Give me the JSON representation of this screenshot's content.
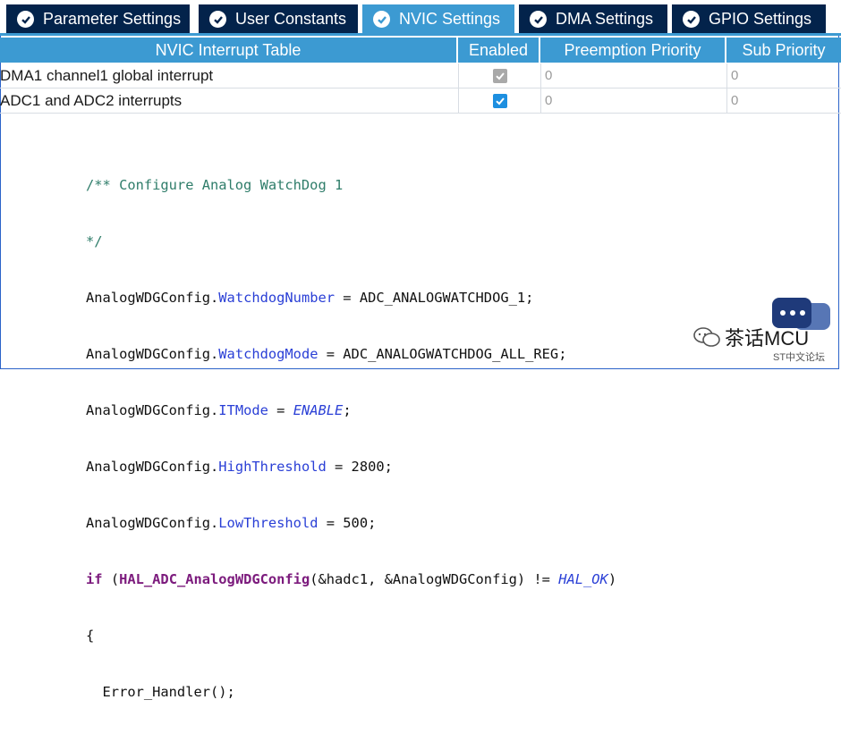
{
  "tabs": [
    {
      "label": "Parameter Settings",
      "active": false
    },
    {
      "label": "User Constants",
      "active": false
    },
    {
      "label": "NVIC Settings",
      "active": true
    },
    {
      "label": "DMA Settings",
      "active": false
    },
    {
      "label": "GPIO Settings",
      "active": false
    }
  ],
  "table": {
    "headers": [
      "NVIC Interrupt Table",
      "Enabled",
      "Preemption Priority",
      "Sub Priority"
    ],
    "rows": [
      {
        "name": "DMA1 channel1 global interrupt",
        "enabled": true,
        "enabled_style": "gray",
        "preemption": "0",
        "sub": "0"
      },
      {
        "name": "ADC1 and ADC2 interrupts",
        "enabled": true,
        "enabled_style": "blue",
        "preemption": "0",
        "sub": "0"
      }
    ]
  },
  "code": {
    "comment1": "/** Configure Analog WatchDog 1",
    "comment2": "*/",
    "obj": "AnalogWDGConfig",
    "l3_field": "WatchdogNumber",
    "l3_rest": " = ADC_ANALOGWATCHDOG_1;",
    "l4_field": "WatchdogMode",
    "l4_rest": " = ADC_ANALOGWATCHDOG_ALL_REG;",
    "l5_field": "ITMode",
    "l5_eq": " = ",
    "l5_val": "ENABLE",
    "l5_end": ";",
    "l6_field": "HighThreshold",
    "l6_rest": " = 2800;",
    "l7_field": "LowThreshold",
    "l7_rest": " = 500;",
    "if_kw": "if",
    "if_open": " (",
    "if_fn": "HAL_ADC_AnalogWDGConfig",
    "if_args": "(&hadc1, &AnalogWDGConfig) != ",
    "if_val": "HAL_OK",
    "if_close": ")",
    "brace_open": "{",
    "handler": "  Error_Handler();",
    "brace_close": "}"
  },
  "watermark": {
    "brand": "茶话MCU",
    "sub": "ST中文论坛",
    "bubble_color": "#1f3a7a"
  },
  "colors": {
    "tab_inactive": "#03234b",
    "tab_active": "#3c9ad2",
    "header_bg": "#3c9ad2",
    "checkbox_blue": "#1d8fe0",
    "checkbox_gray": "#a9a9a9"
  }
}
